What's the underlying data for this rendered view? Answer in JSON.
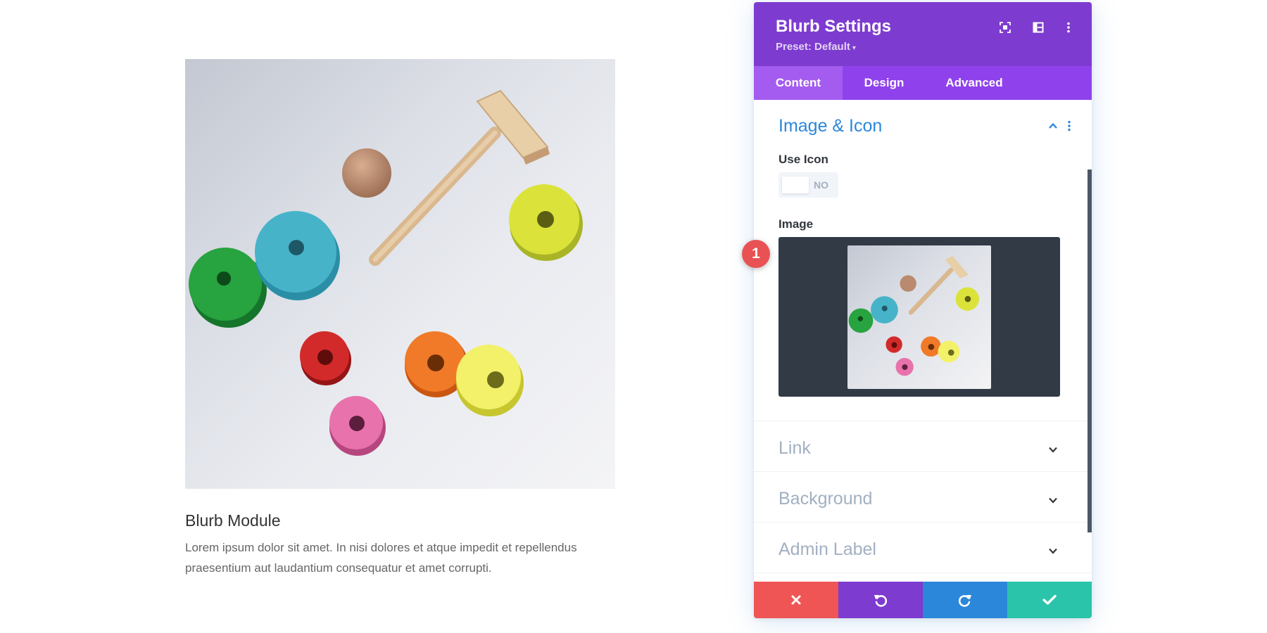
{
  "preview": {
    "image_icon": "wooden-stacking-toy-image",
    "blurb_title": "Blurb Module",
    "blurb_body": "Lorem ipsum dolor sit amet. In nisi dolores et atque impedit et repellendus praesentium aut laudantium consequatur et amet corrupti."
  },
  "modal": {
    "title": "Blurb Settings",
    "preset_label": "Preset: Default",
    "header_icons": [
      "fullscreen-icon",
      "split-view-icon",
      "more-options-icon"
    ],
    "tabs": [
      {
        "label": "Content",
        "active": true
      },
      {
        "label": "Design",
        "active": false
      },
      {
        "label": "Advanced",
        "active": false
      }
    ],
    "sections": {
      "image_icon": {
        "label": "Image & Icon",
        "expanded": true,
        "use_icon_label": "Use Icon",
        "use_icon_value": "NO",
        "image_label": "Image"
      },
      "link": {
        "label": "Link",
        "expanded": false
      },
      "background": {
        "label": "Background",
        "expanded": false
      },
      "admin_label": {
        "label": "Admin Label",
        "expanded": false
      }
    },
    "footer": [
      {
        "icon": "close-icon",
        "color": "#ef5555"
      },
      {
        "icon": "undo-icon",
        "color": "#7e3bd0"
      },
      {
        "icon": "redo-icon",
        "color": "#2b87da"
      },
      {
        "icon": "check-icon",
        "color": "#29c4a9"
      }
    ]
  },
  "badge": {
    "number": "1",
    "color": "#e85254"
  },
  "colors": {
    "header_purple": "#7e3bd0",
    "tab_purple": "#8f42ec",
    "active_tab": "#a45cf0",
    "section_blue": "#2b87da",
    "muted_label": "#a2b0c1"
  }
}
